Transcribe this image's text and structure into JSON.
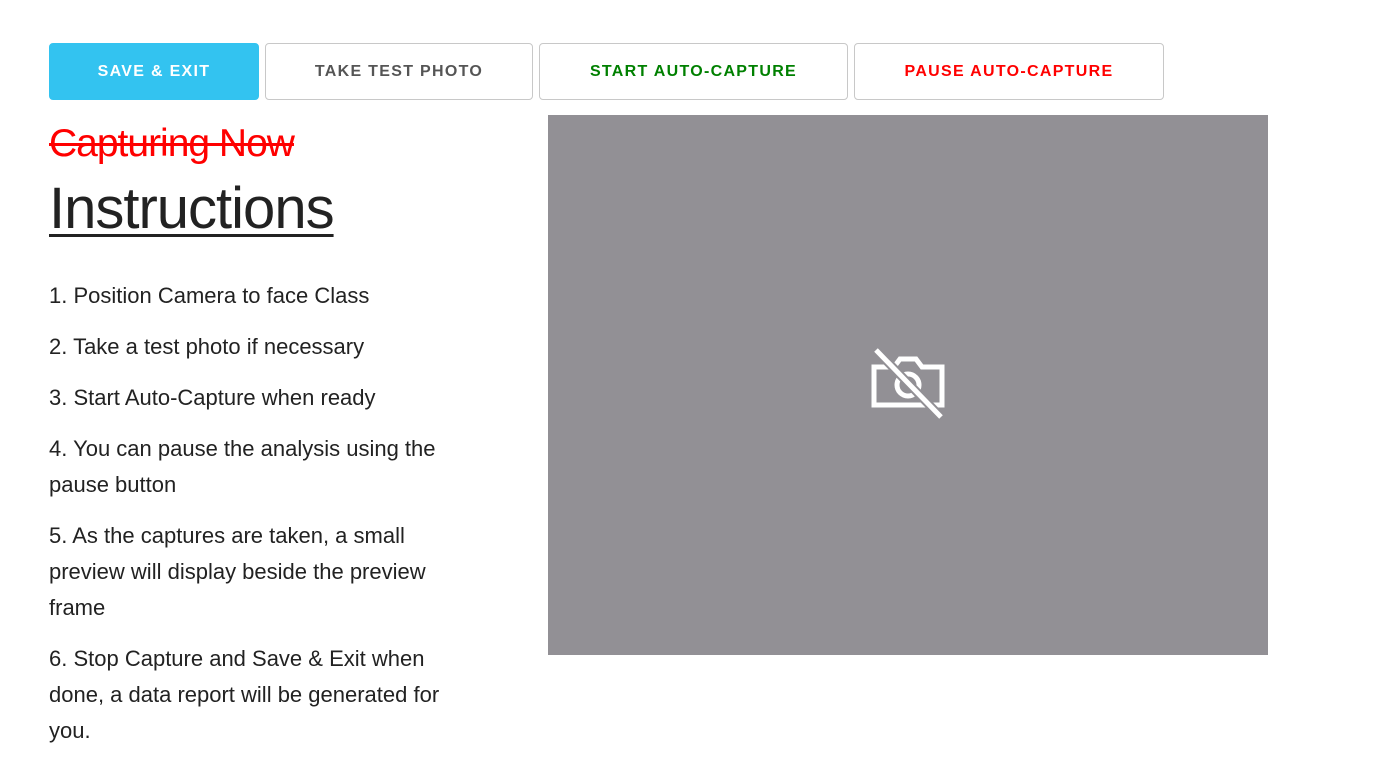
{
  "toolbar": {
    "save_exit_label": "SAVE & EXIT",
    "test_photo_label": "TAKE TEST PHOTO",
    "start_label": "START AUTO-CAPTURE",
    "pause_label": "PAUSE AUTO-CAPTURE"
  },
  "status": {
    "text": "Capturing Now",
    "color": "#ff0000"
  },
  "instructions": {
    "title": "Instructions",
    "steps": [
      "1. Position Camera to face Class",
      "2. Take a test photo if necessary",
      "3. Start Auto-Capture when ready",
      "4. You can pause the analysis using the pause button",
      "5. As the captures are taken, a small preview will display beside the preview frame",
      "6. Stop Capture and Save & Exit when done, a data report will be generated for you."
    ]
  },
  "preview": {
    "icon": "camera-off-icon",
    "background": "#929095"
  },
  "colors": {
    "primary": "#33c3f0",
    "start": "#008000",
    "pause": "#ff0000"
  }
}
